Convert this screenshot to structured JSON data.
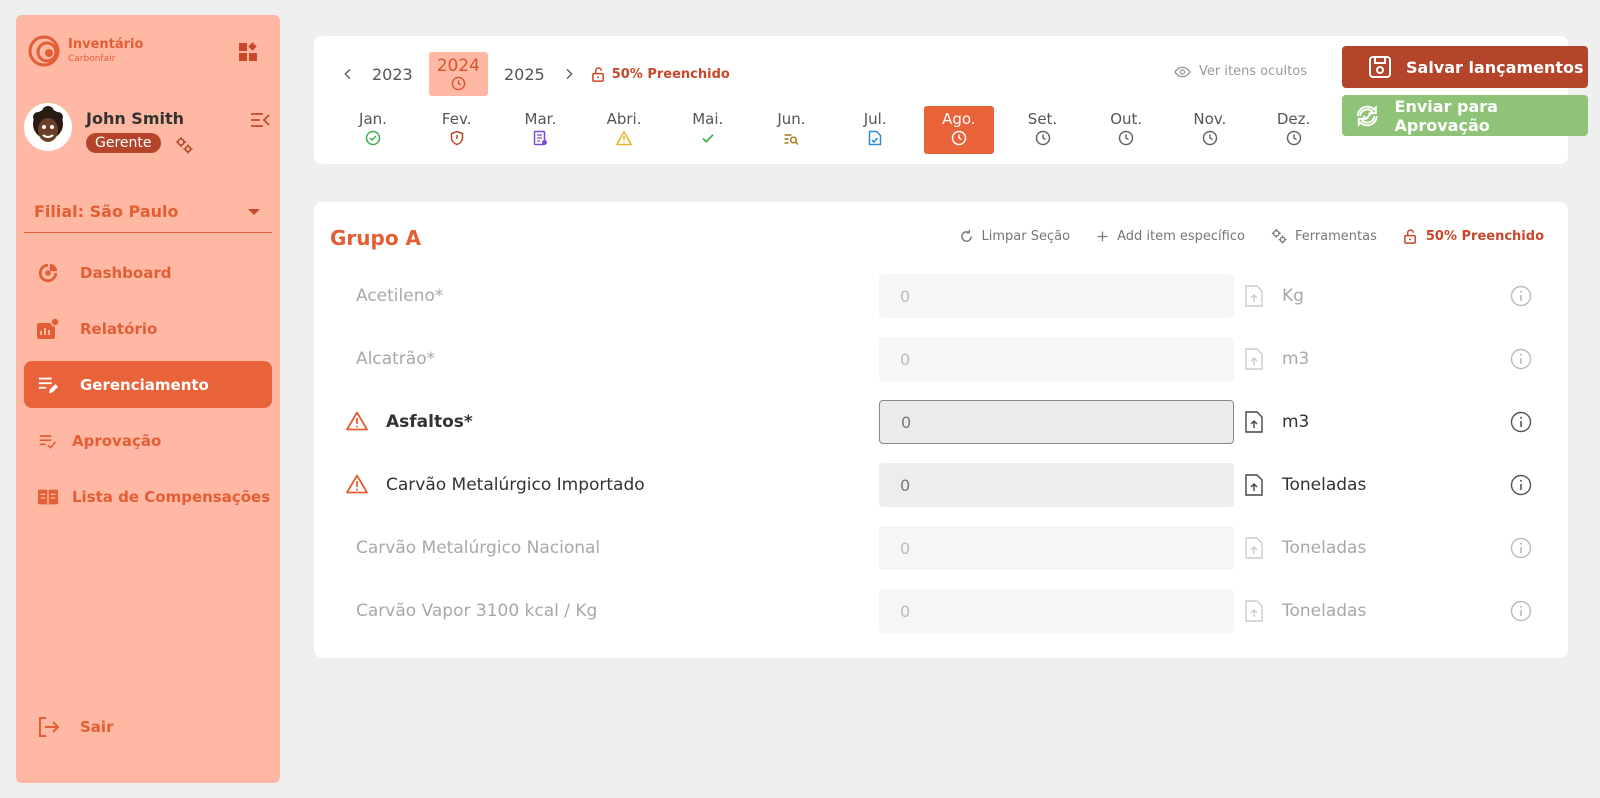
{
  "brand": {
    "name": "Inventário",
    "sub": "Carbonfair"
  },
  "user": {
    "name": "John Smith",
    "role": "Gerente"
  },
  "branch": {
    "label": "Filial: São Paulo"
  },
  "nav": {
    "dashboard": "Dashboard",
    "relatorio": "Relatório",
    "gerenciamento": "Gerenciamento",
    "aprovacao": "Aprovação",
    "compensacoes": "Lista de Compensações",
    "sair": "Sair"
  },
  "years": {
    "prev": "2023",
    "current": "2024",
    "next": "2025"
  },
  "fill_status": "50% Preenchido",
  "hidden_items": "Ver itens ocultos",
  "buttons": {
    "save": "Salvar lançamentos",
    "send": "Enviar para Aprovação"
  },
  "months": [
    {
      "label": "Jan.",
      "icon": "check-circle-icon"
    },
    {
      "label": "Fev.",
      "icon": "shield-icon"
    },
    {
      "label": "Mar.",
      "icon": "document-icon"
    },
    {
      "label": "Abri.",
      "icon": "warning-icon"
    },
    {
      "label": "Mai.",
      "icon": "check-icon"
    },
    {
      "label": "Jun.",
      "icon": "search-list-icon"
    },
    {
      "label": "Jul.",
      "icon": "file-check-icon"
    },
    {
      "label": "Ago.",
      "icon": "clock-icon"
    },
    {
      "label": "Set.",
      "icon": "clock-icon"
    },
    {
      "label": "Out.",
      "icon": "clock-icon"
    },
    {
      "label": "Nov.",
      "icon": "clock-icon"
    },
    {
      "label": "Dez.",
      "icon": "clock-icon"
    }
  ],
  "group": {
    "title": "Grupo A",
    "tools": {
      "clear": "Limpar Seção",
      "add": "Add item específico",
      "tools": "Ferramentas",
      "fill": "50% Preenchido"
    },
    "rows": [
      {
        "label": "Acetileno*",
        "value": "0",
        "unit": "Kg"
      },
      {
        "label": "Alcatrão*",
        "value": "0",
        "unit": "m3"
      },
      {
        "label": "Asfaltos*",
        "value": "0",
        "unit": "m3"
      },
      {
        "label": "Carvão Metalúrgico Importado",
        "value": "0",
        "unit": "Toneladas"
      },
      {
        "label": "Carvão Metalúrgico Nacional",
        "value": "0",
        "unit": "Toneladas"
      },
      {
        "label": "Carvão Vapor 3100 kcal / Kg",
        "value": "0",
        "unit": "Toneladas"
      }
    ]
  },
  "colors": {
    "accent": "#e8623a",
    "sidebar": "#ffb8a3",
    "save": "#b5452a",
    "send": "#8fc377"
  }
}
